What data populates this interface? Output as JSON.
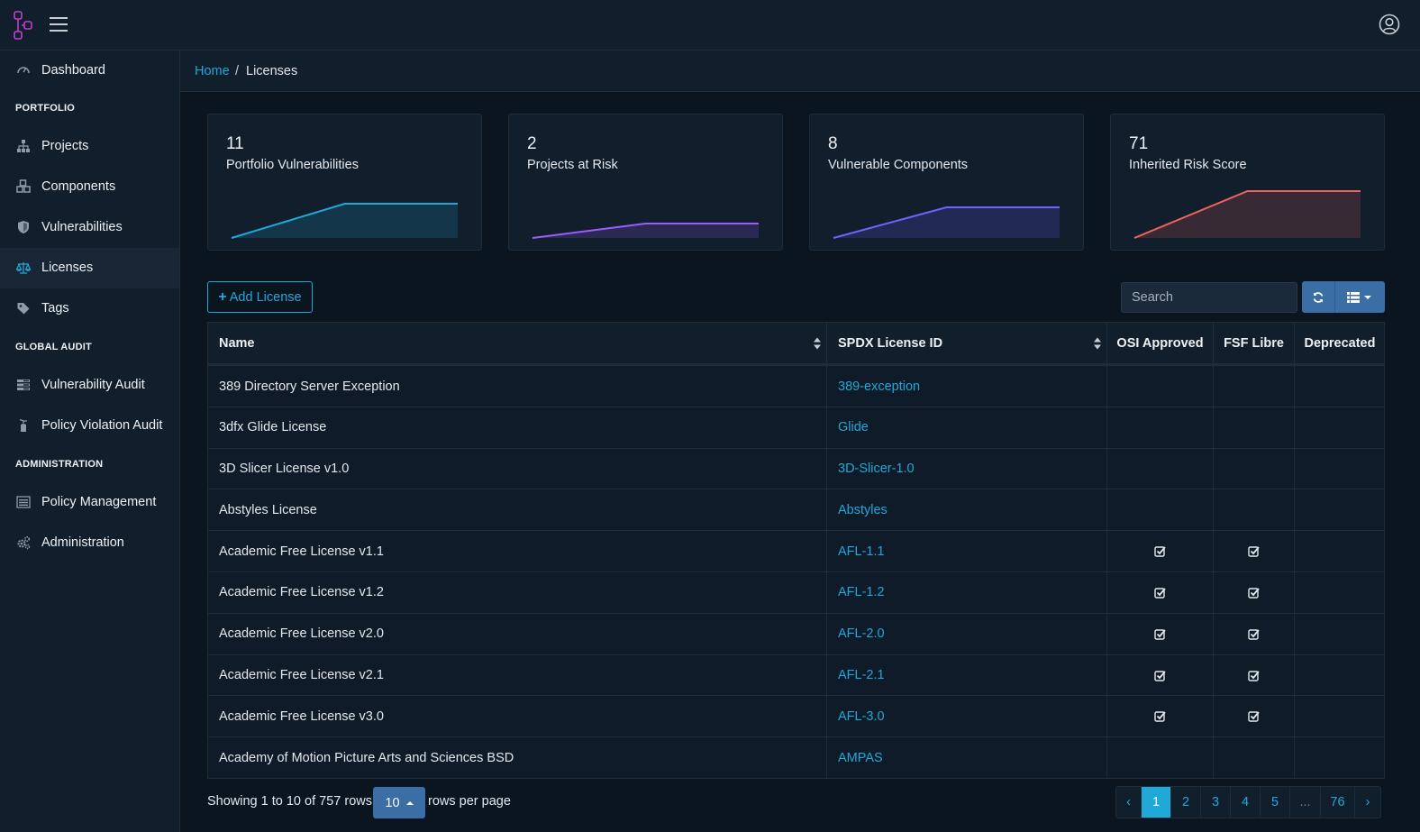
{
  "header": {
    "logo_icon": "dependency-track-logo",
    "menu_icon": "hamburger-icon",
    "user_icon": "user-circle-icon"
  },
  "sidebar": {
    "dashboard": "Dashboard",
    "sections": {
      "portfolio": "PORTFOLIO",
      "global_audit": "GLOBAL AUDIT",
      "administration": "ADMINISTRATION"
    },
    "items": {
      "projects": "Projects",
      "components": "Components",
      "vulnerabilities": "Vulnerabilities",
      "licenses": "Licenses",
      "tags": "Tags",
      "vulnerability_audit": "Vulnerability Audit",
      "policy_violation_audit": "Policy Violation Audit",
      "policy_management": "Policy Management",
      "administration": "Administration"
    }
  },
  "breadcrumb": {
    "home": "Home",
    "separator": "/",
    "current": "Licenses"
  },
  "cards": [
    {
      "value": "11",
      "label": "Portfolio Vulnerabilities",
      "color": "#20a8d8",
      "trend": [
        0,
        1,
        1
      ]
    },
    {
      "value": "2",
      "label": "Projects at Risk",
      "color": "#9d5cff",
      "trend": [
        0,
        1,
        1
      ]
    },
    {
      "value": "8",
      "label": "Vulnerable Components",
      "color": "#6e63ff",
      "trend": [
        0,
        1,
        1
      ]
    },
    {
      "value": "71",
      "label": "Inherited Risk Score",
      "color": "#f0625f",
      "trend": [
        0,
        1,
        1
      ]
    }
  ],
  "toolbar": {
    "add_label": "Add License",
    "search_placeholder": "Search"
  },
  "table": {
    "columns": {
      "name": "Name",
      "spdx": "SPDX License ID",
      "osi": "OSI Approved",
      "fsf": "FSF Libre",
      "deprecated": "Deprecated"
    },
    "rows": [
      {
        "name": "389 Directory Server Exception",
        "spdx": "389-exception",
        "osi": false,
        "fsf": false,
        "deprecated": false
      },
      {
        "name": "3dfx Glide License",
        "spdx": "Glide",
        "osi": false,
        "fsf": false,
        "deprecated": false
      },
      {
        "name": "3D Slicer License v1.0",
        "spdx": "3D-Slicer-1.0",
        "osi": false,
        "fsf": false,
        "deprecated": false
      },
      {
        "name": "Abstyles License",
        "spdx": "Abstyles",
        "osi": false,
        "fsf": false,
        "deprecated": false
      },
      {
        "name": "Academic Free License v1.1",
        "spdx": "AFL-1.1",
        "osi": true,
        "fsf": true,
        "deprecated": false
      },
      {
        "name": "Academic Free License v1.2",
        "spdx": "AFL-1.2",
        "osi": true,
        "fsf": true,
        "deprecated": false
      },
      {
        "name": "Academic Free License v2.0",
        "spdx": "AFL-2.0",
        "osi": true,
        "fsf": true,
        "deprecated": false
      },
      {
        "name": "Academic Free License v2.1",
        "spdx": "AFL-2.1",
        "osi": true,
        "fsf": true,
        "deprecated": false
      },
      {
        "name": "Academic Free License v3.0",
        "spdx": "AFL-3.0",
        "osi": true,
        "fsf": true,
        "deprecated": false
      },
      {
        "name": "Academy of Motion Picture Arts and Sciences BSD",
        "spdx": "AMPAS",
        "osi": false,
        "fsf": false,
        "deprecated": false
      }
    ]
  },
  "footer": {
    "showing": "Showing 1 to 10 of 757 rows",
    "rows_per_page_value": "10",
    "rows_per_page_label": "rows per page",
    "pages": [
      "‹",
      "1",
      "2",
      "3",
      "4",
      "5",
      "...",
      "76",
      "›"
    ],
    "active_page": "1"
  }
}
